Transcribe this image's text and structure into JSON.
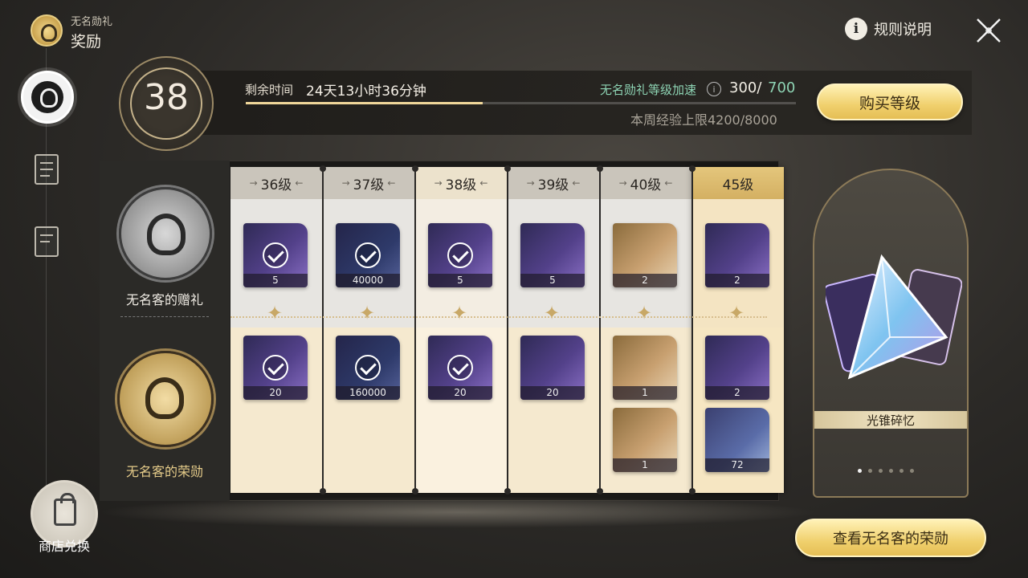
{
  "header": {
    "subtitle": "无名勋礼",
    "title": "奖励",
    "rules_label": "规则说明"
  },
  "left_rail": {
    "shop_label": "商店兑换"
  },
  "level_bar": {
    "level": "38",
    "time_label": "剩余时间",
    "time_value": "24天13小时36分钟",
    "time_progress": 0.43,
    "speed_label": "无名勋礼等级加速",
    "speed_current": "300/",
    "speed_max": "700",
    "weekly_cap": "本周经验上限4200/8000",
    "buy_label": "购买等级"
  },
  "tiers": {
    "free_label": "无名客的赠礼",
    "paid_label": "无名客的荣勋"
  },
  "columns": [
    {
      "level": "36级",
      "state": "claimed",
      "free": [
        {
          "qty": "5",
          "art": "purple"
        }
      ],
      "paid": [
        {
          "qty": "20",
          "art": "purple"
        }
      ]
    },
    {
      "level": "37级",
      "state": "claimed",
      "free": [
        {
          "qty": "40000",
          "art": "dark"
        }
      ],
      "paid": [
        {
          "qty": "160000",
          "art": "dark"
        }
      ]
    },
    {
      "level": "38级",
      "state": "current",
      "free": [
        {
          "qty": "5",
          "art": "purple"
        }
      ],
      "paid": [
        {
          "qty": "20",
          "art": "purple"
        }
      ]
    },
    {
      "level": "39级",
      "state": "locked",
      "free": [
        {
          "qty": "5",
          "art": "purple"
        }
      ],
      "paid": [
        {
          "qty": "20",
          "art": "purple"
        }
      ]
    },
    {
      "level": "40级",
      "state": "locked",
      "free": [
        {
          "qty": "2",
          "art": "gold"
        }
      ],
      "paid": [
        {
          "qty": "1",
          "art": "gold"
        },
        {
          "qty": "1",
          "art": "gold"
        }
      ]
    },
    {
      "level": "45级",
      "state": "future",
      "free": [
        {
          "qty": "2",
          "art": "purple"
        }
      ],
      "paid": [
        {
          "qty": "2",
          "art": "purple"
        },
        {
          "qty": "72",
          "art": "bag"
        }
      ]
    }
  ],
  "showcase": {
    "name": "光锥碎忆",
    "pages": 6,
    "active_page": 1,
    "view_label": "查看无名客的荣勋"
  },
  "colors": {
    "accent_gold": "#f0d06d",
    "accent_teal": "#8ed4b4"
  }
}
